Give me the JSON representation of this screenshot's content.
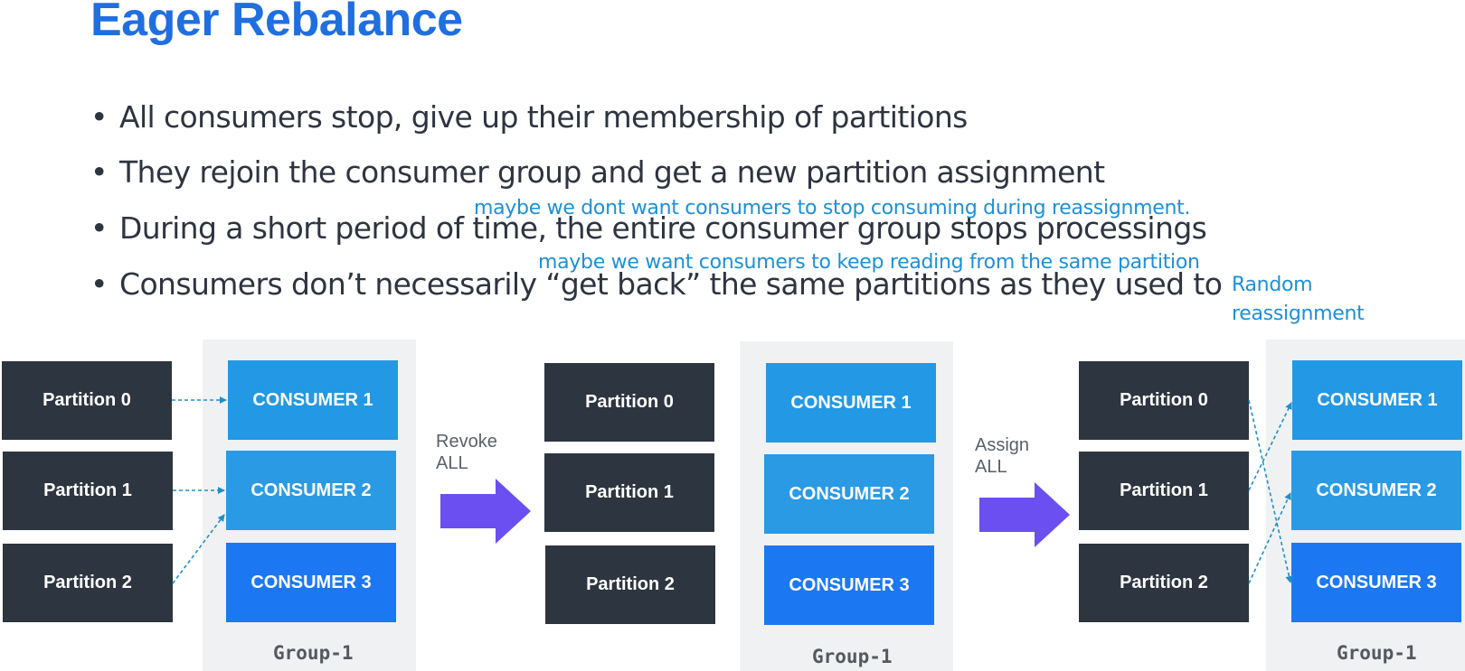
{
  "title": "Eager Rebalance",
  "bullets": [
    "All consumers stop, give up their membership of partitions",
    "They rejoin the consumer group and get a new partition assignment",
    "During a short period of time, the entire consumer group stops processings",
    "Consumers don’t necessarily “get back” the same partitions as they used to"
  ],
  "bullet_glyph": "•",
  "annotations": {
    "note1": "maybe we dont want consumers to stop consuming during reassignment.",
    "note2": "maybe we want consumers to keep reading from the same partition",
    "note3": "Random reassignment"
  },
  "diagram": {
    "partitions": [
      "Partition 0",
      "Partition 1",
      "Partition 2"
    ],
    "consumers": [
      "CONSUMER 1",
      "CONSUMER 2",
      "CONSUMER 3"
    ],
    "group_label": "Group-1",
    "step1_label": [
      "Revoke",
      "ALL"
    ],
    "step2_label": [
      "Assign",
      "ALL"
    ]
  },
  "colors": {
    "title": "#1f6fe0",
    "annotation": "#1d90d8",
    "partition_box": "#2d3540",
    "consumer_1": "#2398e4",
    "consumer_2": "#2a9ae4",
    "consumer_3": "#1c78f2",
    "group_background": "#f0f1f3",
    "arrow": "#6b4ff0",
    "connector": "#1f8fc8"
  }
}
